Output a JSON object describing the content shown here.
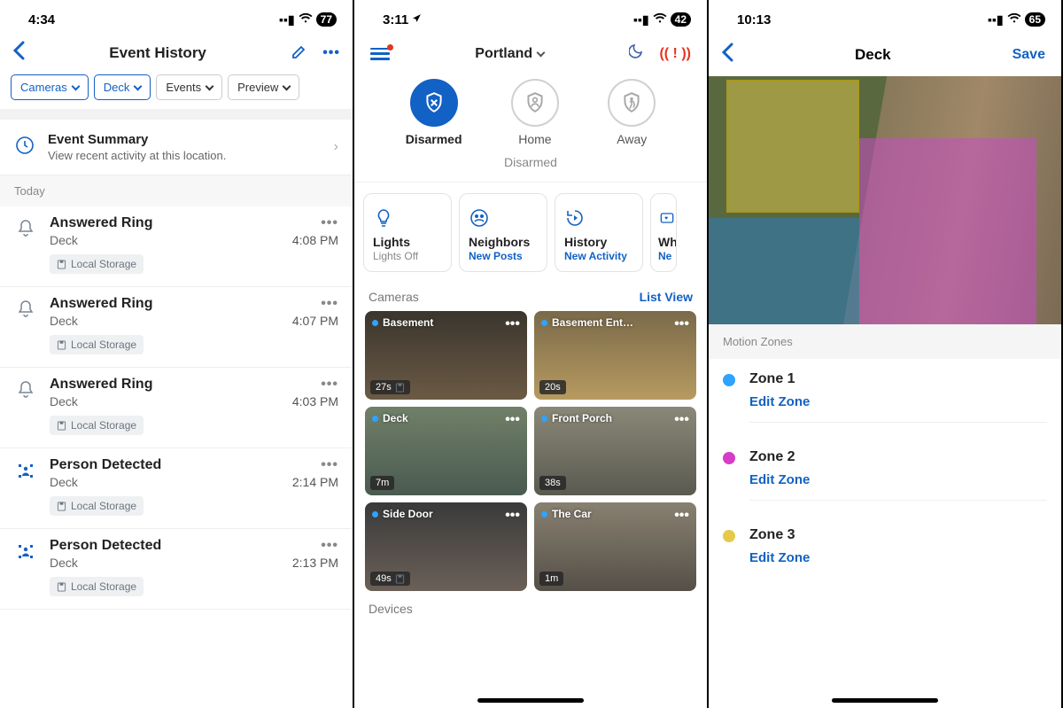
{
  "p1": {
    "status": {
      "time": "4:34",
      "battery": "77"
    },
    "nav": {
      "title": "Event History"
    },
    "filters": [
      {
        "label": "Cameras",
        "selected": true
      },
      {
        "label": "Deck",
        "selected": true
      },
      {
        "label": "Events",
        "selected": false
      },
      {
        "label": "Preview",
        "selected": false
      }
    ],
    "summary": {
      "title": "Event Summary",
      "sub": "View recent activity at this location."
    },
    "today_label": "Today",
    "events": [
      {
        "kind": "ring",
        "title": "Answered Ring",
        "loc": "Deck",
        "time": "4:08 PM",
        "badge": "Local Storage"
      },
      {
        "kind": "ring",
        "title": "Answered Ring",
        "loc": "Deck",
        "time": "4:07 PM",
        "badge": "Local Storage"
      },
      {
        "kind": "ring",
        "title": "Answered Ring",
        "loc": "Deck",
        "time": "4:03 PM",
        "badge": "Local Storage"
      },
      {
        "kind": "person",
        "title": "Person Detected",
        "loc": "Deck",
        "time": "2:14 PM",
        "badge": "Local Storage"
      },
      {
        "kind": "person",
        "title": "Person Detected",
        "loc": "Deck",
        "time": "2:13 PM",
        "badge": "Local Storage"
      }
    ]
  },
  "p2": {
    "status": {
      "time": "3:11",
      "battery": "42"
    },
    "nav": {
      "location": "Portland"
    },
    "modes": {
      "items": [
        "Disarmed",
        "Home",
        "Away"
      ],
      "active": 0,
      "status": "Disarmed"
    },
    "tiles": [
      {
        "title": "Lights",
        "sub": "Lights Off",
        "sub_style": "grey"
      },
      {
        "title": "Neighbors",
        "sub": "New Posts",
        "sub_style": "blue"
      },
      {
        "title": "History",
        "sub": "New Activity",
        "sub_style": "blue"
      },
      {
        "title": "Wh",
        "sub": "Ne",
        "sub_style": "blue"
      }
    ],
    "cams_header": {
      "label": "Cameras",
      "link": "List View"
    },
    "cams": [
      {
        "name": "Basement",
        "age": "27s",
        "save": true,
        "cls": "c1"
      },
      {
        "name": "Basement Ent…",
        "age": "20s",
        "save": false,
        "cls": "c2"
      },
      {
        "name": "Deck",
        "age": "7m",
        "save": false,
        "cls": "c3"
      },
      {
        "name": "Front Porch",
        "age": "38s",
        "save": false,
        "cls": "c4"
      },
      {
        "name": "Side Door",
        "age": "49s",
        "save": true,
        "cls": "c5"
      },
      {
        "name": "The Car",
        "age": "1m",
        "save": false,
        "cls": "c6"
      }
    ],
    "devices_label": "Devices"
  },
  "p3": {
    "status": {
      "time": "10:13",
      "battery": "65"
    },
    "nav": {
      "title": "Deck",
      "save": "Save"
    },
    "zones_header": "Motion Zones",
    "zones": [
      {
        "name": "Zone 1",
        "edit": "Edit Zone",
        "dot": "zd-blue"
      },
      {
        "name": "Zone 2",
        "edit": "Edit Zone",
        "dot": "zd-mag"
      },
      {
        "name": "Zone 3",
        "edit": "Edit Zone",
        "dot": "zd-yel"
      }
    ]
  }
}
